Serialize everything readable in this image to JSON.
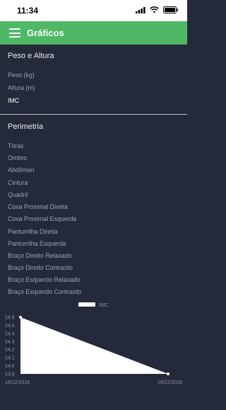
{
  "status_bar": {
    "time": "11:34"
  },
  "app_bar": {
    "title": "Gráficos"
  },
  "sections": [
    {
      "title": "Peso e Altura",
      "items": [
        "Peso (kg)",
        "Altura (m)",
        "IMC"
      ]
    },
    {
      "title": "Perimetria",
      "items": [
        "Tórax",
        "Ombro",
        "Abdômen",
        "Cintura",
        "Quadril",
        "Coxa Proximal Direita",
        "Coxa Proximal Esquerda",
        "Panturrilha Direita",
        "Panturrilha Esquerda",
        "Braço Direito Relaxado",
        "Braço Direito Contraído",
        "Braço Esquerdo Relaxado",
        "Braço Esquerdo Contraído"
      ]
    }
  ],
  "selected_item": "IMC",
  "chart_data": {
    "type": "area",
    "series": [
      {
        "name": "IMC",
        "values": [
          24.6,
          23.9
        ]
      }
    ],
    "x": [
      "16/12/2018",
      "16/12/2018"
    ],
    "y_ticks": [
      "24.6",
      "24.5",
      "24.4",
      "24.3",
      "24.2",
      "24.1",
      "24.0",
      "23.9"
    ],
    "ylim": [
      23.9,
      24.6
    ],
    "legend_position": "top-center",
    "grid": false,
    "fill_color": "#ffffff"
  }
}
